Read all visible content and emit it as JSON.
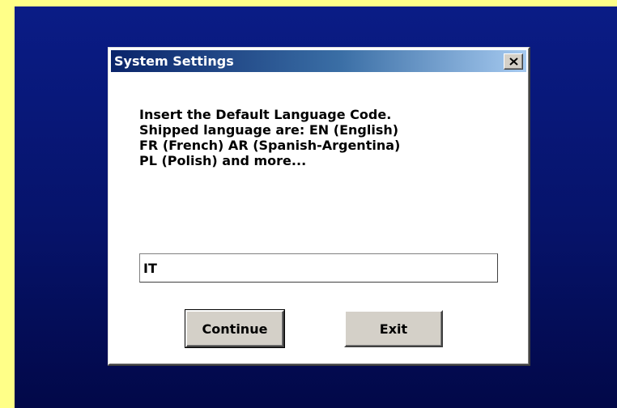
{
  "dialog": {
    "title": "System Settings",
    "close_icon": "close-x-icon",
    "message_lines": [
      "Insert the Default Language Code.",
      "Shipped language are: EN (English)",
      "FR (French) AR (Spanish-Argentina)",
      "PL (Polish) and more..."
    ],
    "language_input": {
      "value": "IT",
      "placeholder": ""
    },
    "buttons": {
      "continue_label": "Continue",
      "exit_label": "Exit"
    }
  },
  "colors": {
    "desktop_top": "#0a1c86",
    "desktop_bottom": "#020848",
    "page_border": "#ffff88",
    "titlebar_start": "#0a246a",
    "titlebar_end": "#a6caf0",
    "button_face": "#d4d0c8"
  }
}
